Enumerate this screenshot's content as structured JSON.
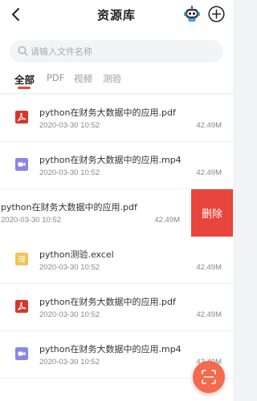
{
  "header": {
    "title": "资源库",
    "back_icon": "chevron-left-icon",
    "robot_icon": "robot-icon",
    "add_icon": "plus-circle-icon"
  },
  "search": {
    "placeholder": "请输入文件名称",
    "icon": "search-icon"
  },
  "tabs": [
    {
      "label": "全部",
      "active": true
    },
    {
      "label": "PDF",
      "active": false
    },
    {
      "label": "视频",
      "active": false
    },
    {
      "label": "测验",
      "active": false
    }
  ],
  "files": [
    {
      "name": "python在财务大数据中的应用.pdf",
      "date": "2020-03-30 10:52",
      "size": "42.49M",
      "type": "pdf"
    },
    {
      "name": "python在财务大数据中的应用.mp4",
      "date": "2020-03-30 10:52",
      "size": "42.49M",
      "type": "video"
    },
    {
      "name": "python在财务大数据中的应用.pdf",
      "date": "2020-03-30 10:52",
      "size": "42.49M",
      "type": "pdf",
      "swiped": true
    },
    {
      "name": "python测验.excel",
      "date": "2020-03-30 10:52",
      "size": "42.49M",
      "type": "quiz"
    },
    {
      "name": "python在财务大数据中的应用.pdf",
      "date": "2020-03-30 10:52",
      "size": "42.49M",
      "type": "pdf"
    },
    {
      "name": "python在财务大数据中的应用.mp4",
      "date": "2020-03-30 10:52",
      "size": "42.49M",
      "type": "video"
    }
  ],
  "delete_label": "删除",
  "fab": {
    "icon": "scan-icon"
  },
  "colors": {
    "accent": "#e8453c",
    "pdf": "#d9362b",
    "video": "#8b86e8",
    "quiz": "#f2c35b"
  }
}
